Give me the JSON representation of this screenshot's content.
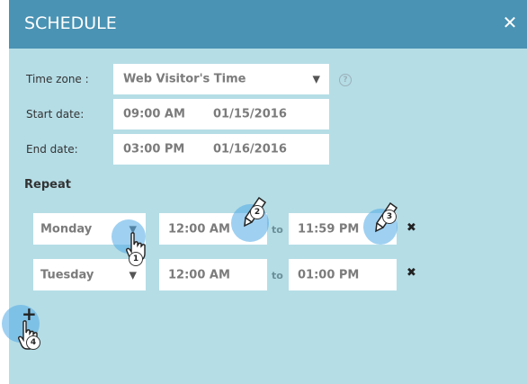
{
  "dialog": {
    "title": "SCHEDULE",
    "close_icon": "close-icon"
  },
  "timezone": {
    "label": "Time zone :",
    "value": "Web Visitor's Time",
    "help_glyph": "?"
  },
  "start_date": {
    "label": "Start date:",
    "time": "09:00 AM",
    "date": "01/15/2016"
  },
  "end_date": {
    "label": "End date:",
    "time": "03:00 PM",
    "date": "01/16/2016"
  },
  "repeat": {
    "label": "Repeat",
    "to_label": "to",
    "rows": [
      {
        "day": "Monday",
        "from": "12:00 AM",
        "to": "11:59 PM"
      },
      {
        "day": "Tuesday",
        "from": "12:00 AM",
        "to": "01:00 PM"
      }
    ],
    "add_glyph": "+"
  },
  "annotations": {
    "step1": "1",
    "step2": "2",
    "step3": "3",
    "step4": "4"
  },
  "colors": {
    "header": "#4a93b4",
    "panel": "#b5dde6",
    "highlight": "#50aae6"
  }
}
